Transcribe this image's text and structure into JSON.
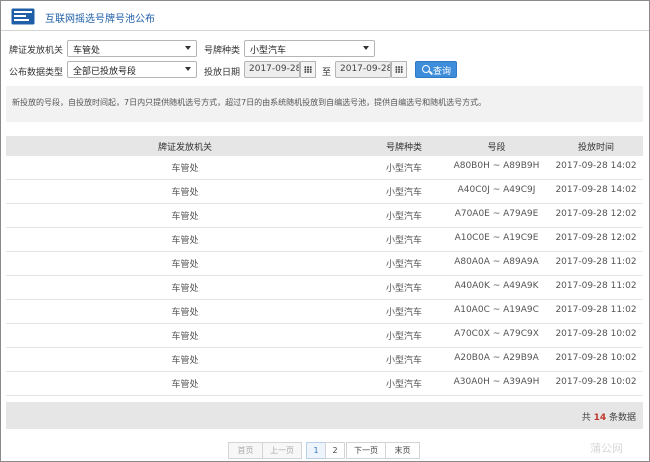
{
  "header": {
    "title": "互联网摇选号牌号池公布",
    "logo_icon": "monitor-icon"
  },
  "filters": {
    "issuer_label": "牌证发放机关",
    "issuer_value": "车管处",
    "plate_type_label": "号牌种类",
    "plate_type_value": "小型汽车",
    "publish_type_label": "公布数据类型",
    "publish_type_value": "全部已投放号段",
    "date_label": "投放日期",
    "date_from": "2017-09-28",
    "date_sep": "至",
    "date_to": "2017-09-28",
    "query_label": "查询"
  },
  "notice": "新投放的号段，自投放时间起，7日内只提供随机选号方式，超过7日的由系统随机投放到自编选号池，提供自编选号和随机选号方式。",
  "table": {
    "headers": [
      "牌证发放机关",
      "号牌种类",
      "号段",
      "投放时间"
    ],
    "rows": [
      [
        "车管处",
        "小型汽车",
        "A80B0H ~ A89B9H",
        "2017-09-28 14:02"
      ],
      [
        "车管处",
        "小型汽车",
        "A40C0J ~ A49C9J",
        "2017-09-28 14:02"
      ],
      [
        "车管处",
        "小型汽车",
        "A70A0E ~ A79A9E",
        "2017-09-28 12:02"
      ],
      [
        "车管处",
        "小型汽车",
        "A10C0E ~ A19C9E",
        "2017-09-28 12:02"
      ],
      [
        "车管处",
        "小型汽车",
        "A80A0A ~ A89A9A",
        "2017-09-28 11:02"
      ],
      [
        "车管处",
        "小型汽车",
        "A40A0K ~ A49A9K",
        "2017-09-28 11:02"
      ],
      [
        "车管处",
        "小型汽车",
        "A10A0C ~ A19A9C",
        "2017-09-28 11:02"
      ],
      [
        "车管处",
        "小型汽车",
        "A70C0X ~ A79C9X",
        "2017-09-28 10:02"
      ],
      [
        "车管处",
        "小型汽车",
        "A20B0A ~ A29B9A",
        "2017-09-28 10:02"
      ],
      [
        "车管处",
        "小型汽车",
        "A30A0H ~ A39A9H",
        "2017-09-28 10:02"
      ]
    ]
  },
  "summary": {
    "prefix": "共",
    "count": "14",
    "suffix": "条数据"
  },
  "pagination": {
    "first": "首页",
    "prev": "上一页",
    "pages": [
      "1",
      "2"
    ],
    "current": "1",
    "next": "下一页",
    "last": "末页"
  },
  "watermark": "蒲公网",
  "colors": {
    "accent": "#3e8ddb",
    "title": "#1f5fa8",
    "count": "#c0392b"
  }
}
